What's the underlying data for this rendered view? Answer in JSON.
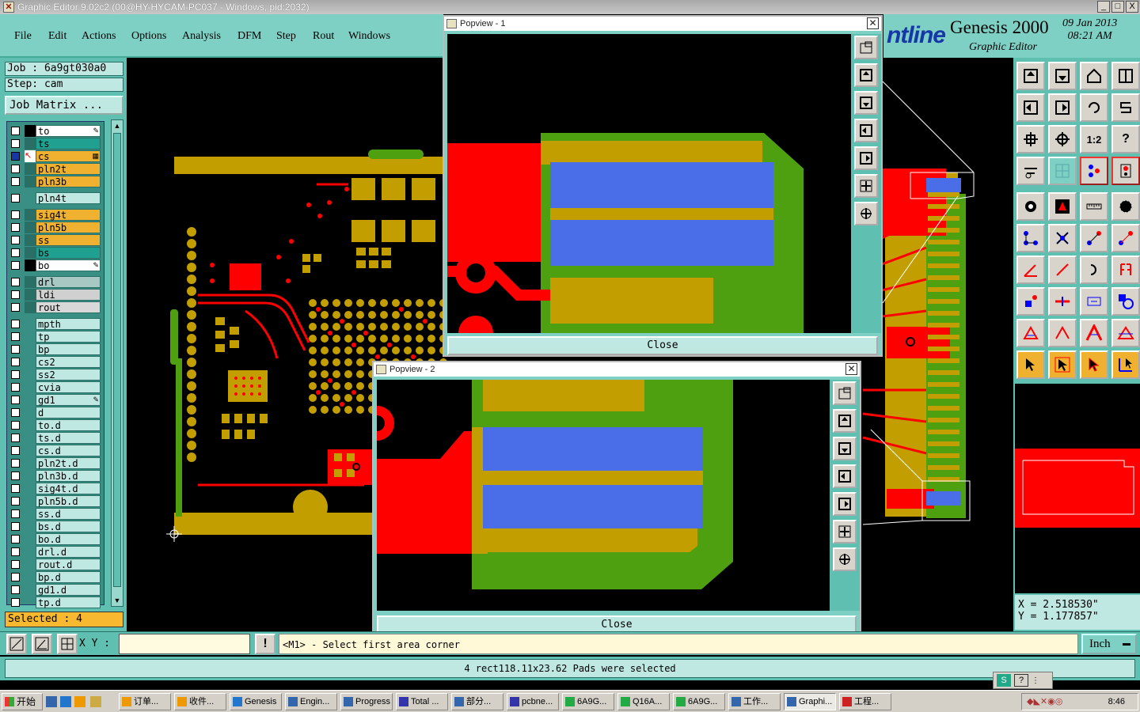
{
  "window": {
    "title": "Graphic Editor 9.02c2 (00@HY-HYCAM-PC037 - Windows, pid:2032)",
    "min": "_",
    "max": "□",
    "close": "X"
  },
  "menu": [
    "File",
    "Edit",
    "Actions",
    "Options",
    "Analysis",
    "DFM",
    "Step",
    "Rout",
    "Windows"
  ],
  "logo": {
    "brand": "ntline",
    "product": "Genesis 2000",
    "subtitle": "Graphic Editor",
    "date": "09 Jan 2013",
    "time": "08:21 AM"
  },
  "job": {
    "job_label": "Job : 6a9gt030a0",
    "step_label": "Step: cam",
    "matrix_button": "Job Matrix ..."
  },
  "layers": [
    {
      "name": "to",
      "color": "#ffffff",
      "icon": "pen-icon"
    },
    {
      "name": "ts",
      "color": "#20a090"
    },
    {
      "name": "cs",
      "color": "#f0b030",
      "active": true,
      "icon": "grid-icon"
    },
    {
      "name": "pln2t",
      "color": "#f0b030"
    },
    {
      "name": "pln3b",
      "color": "#f0b030"
    },
    {
      "name": "pln4t",
      "color": "#bfe8e2",
      "gap": true
    },
    {
      "name": "sig4t",
      "color": "#f0b030",
      "gap": true
    },
    {
      "name": "pln5b",
      "color": "#f0b030"
    },
    {
      "name": "ss",
      "color": "#f0b030"
    },
    {
      "name": "bs",
      "color": "#20a090"
    },
    {
      "name": "bo",
      "color": "#ffffff",
      "icon": "pen-icon"
    },
    {
      "name": "drl",
      "color": "#a8c8c4",
      "gap": true
    },
    {
      "name": "ldi",
      "color": "#d0d0d0"
    },
    {
      "name": "rout",
      "color": "#d8d8d8"
    },
    {
      "name": "mpth",
      "color": "#bfe8e2",
      "gap": true
    },
    {
      "name": "tp",
      "color": "#bfe8e2"
    },
    {
      "name": "bp",
      "color": "#bfe8e2"
    },
    {
      "name": "cs2",
      "color": "#bfe8e2"
    },
    {
      "name": "ss2",
      "color": "#bfe8e2"
    },
    {
      "name": "cvia",
      "color": "#bfe8e2"
    },
    {
      "name": "gd1",
      "color": "#bfe8e2",
      "icon": "pen-icon"
    },
    {
      "name": "d",
      "color": "#bfe8e2"
    },
    {
      "name": "to.d",
      "color": "#bfe8e2"
    },
    {
      "name": "ts.d",
      "color": "#bfe8e2"
    },
    {
      "name": "cs.d",
      "color": "#bfe8e2"
    },
    {
      "name": "pln2t.d",
      "color": "#bfe8e2"
    },
    {
      "name": "pln3b.d",
      "color": "#bfe8e2"
    },
    {
      "name": "sig4t.d",
      "color": "#bfe8e2"
    },
    {
      "name": "pln5b.d",
      "color": "#bfe8e2"
    },
    {
      "name": "ss.d",
      "color": "#bfe8e2"
    },
    {
      "name": "bs.d",
      "color": "#bfe8e2"
    },
    {
      "name": "bo.d",
      "color": "#bfe8e2"
    },
    {
      "name": "drl.d",
      "color": "#bfe8e2"
    },
    {
      "name": "rout.d",
      "color": "#bfe8e2"
    },
    {
      "name": "bp.d",
      "color": "#bfe8e2"
    },
    {
      "name": "gd1.d",
      "color": "#bfe8e2"
    },
    {
      "name": "tp.d",
      "color": "#bfe8e2"
    }
  ],
  "selected_label": "Selected : 4",
  "popview1": {
    "title": "Popview - 1",
    "close": "Close"
  },
  "popview2": {
    "title": "Popview - 2",
    "close": "Close"
  },
  "coords": {
    "x": "X = 2.518530\"",
    "y": "Y = 1.177857\""
  },
  "command": {
    "xy_label": "X Y :",
    "xy_value": "",
    "prompt": "<M1> - Select first area corner",
    "units": "Inch"
  },
  "status": "4 rect118.11x23.62 Pads were selected",
  "colors": {
    "panel": "#5fbfb0",
    "menu": "#7fd0c4",
    "red": "#ff0000",
    "olive": "#c29e00",
    "green": "#4ea010",
    "blue": "#4a6ee8"
  },
  "taskbar": {
    "start": "开始",
    "tasks": [
      "订单...",
      "收件...",
      "Genesis",
      "Engin...",
      "Progress",
      "Total ...",
      "部分...",
      "pcbne...",
      "6A9G...",
      "Q16A...",
      "6A9G...",
      "工作...",
      "Graphi...",
      "工程..."
    ],
    "clock": "8:46"
  }
}
